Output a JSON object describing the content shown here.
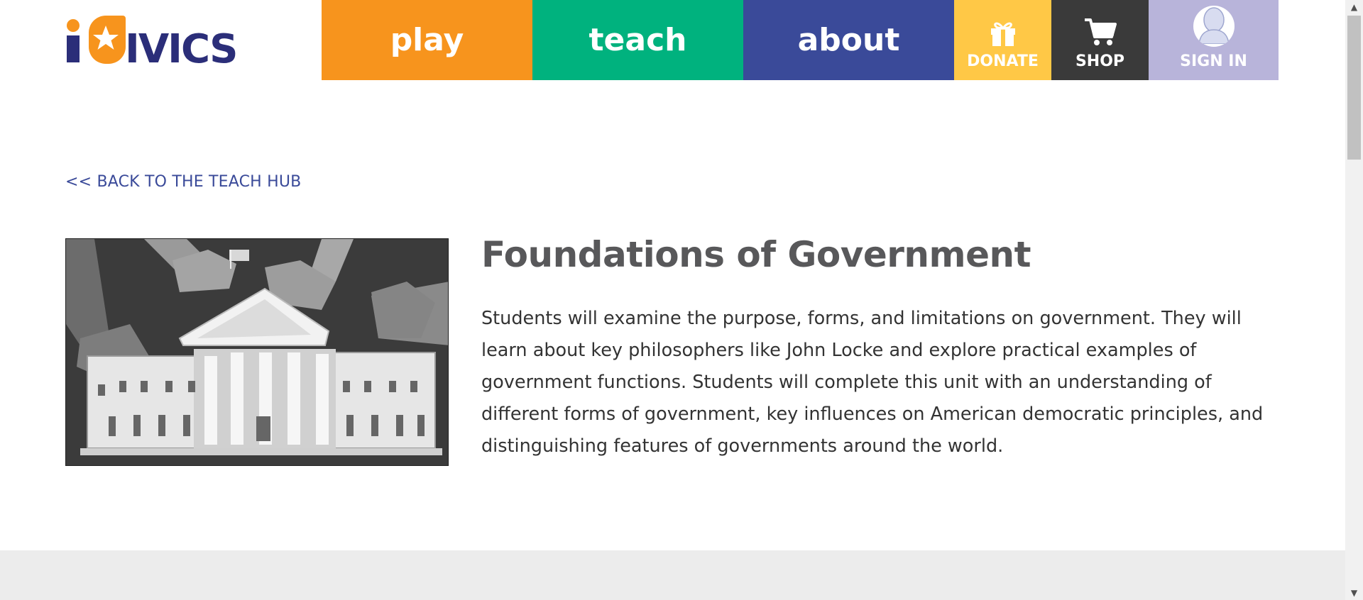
{
  "brand": {
    "logo_text": "iCivics",
    "logo_display": "iCIVICS"
  },
  "nav": {
    "play": "play",
    "teach": "teach",
    "about": "about",
    "donate": "DONATE",
    "shop": "SHOP",
    "sign_in": "SIGN IN"
  },
  "back_link": "<< BACK TO THE TEACH HUB",
  "unit": {
    "title": "Foundations of Government",
    "description": "Students will examine the purpose, forms, and limitations on government. They will learn about key philosophers like John Locke and explore practical examples of government functions. Students will complete this unit with an understanding of different forms of government, key influences on American democratic principles, and distinguishing features of governments around the world."
  },
  "colors": {
    "play": "#f7941d",
    "teach": "#00b27e",
    "about": "#3a4a99",
    "donate": "#ffc846",
    "shop": "#3a3a3a",
    "sign_in": "#b8b4da",
    "logo_navy": "#2b2e79"
  },
  "icons": {
    "donate": "gift-icon",
    "shop": "cart-icon",
    "sign_in": "avatar-icon",
    "logo": "star-icon"
  }
}
